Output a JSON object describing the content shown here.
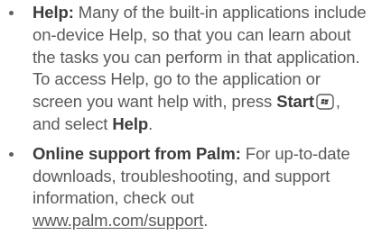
{
  "help": {
    "title": "Help:",
    "text_before_start": " Many of the built-in applications include on-device Help, so that you can learn about the tasks you can perform in that application. To access Help, go to the application or screen you want help with, press ",
    "start_label": "Start",
    "text_before_help": ", and select ",
    "help_label": "Help",
    "text_end": ".",
    "icon": "windows-start-key-icon"
  },
  "online_support": {
    "title": "Online support from Palm:",
    "text": " For up-to-date downloads, troubleshooting, and support information, check out ",
    "link": "www.palm.com/support",
    "text_end": "."
  }
}
